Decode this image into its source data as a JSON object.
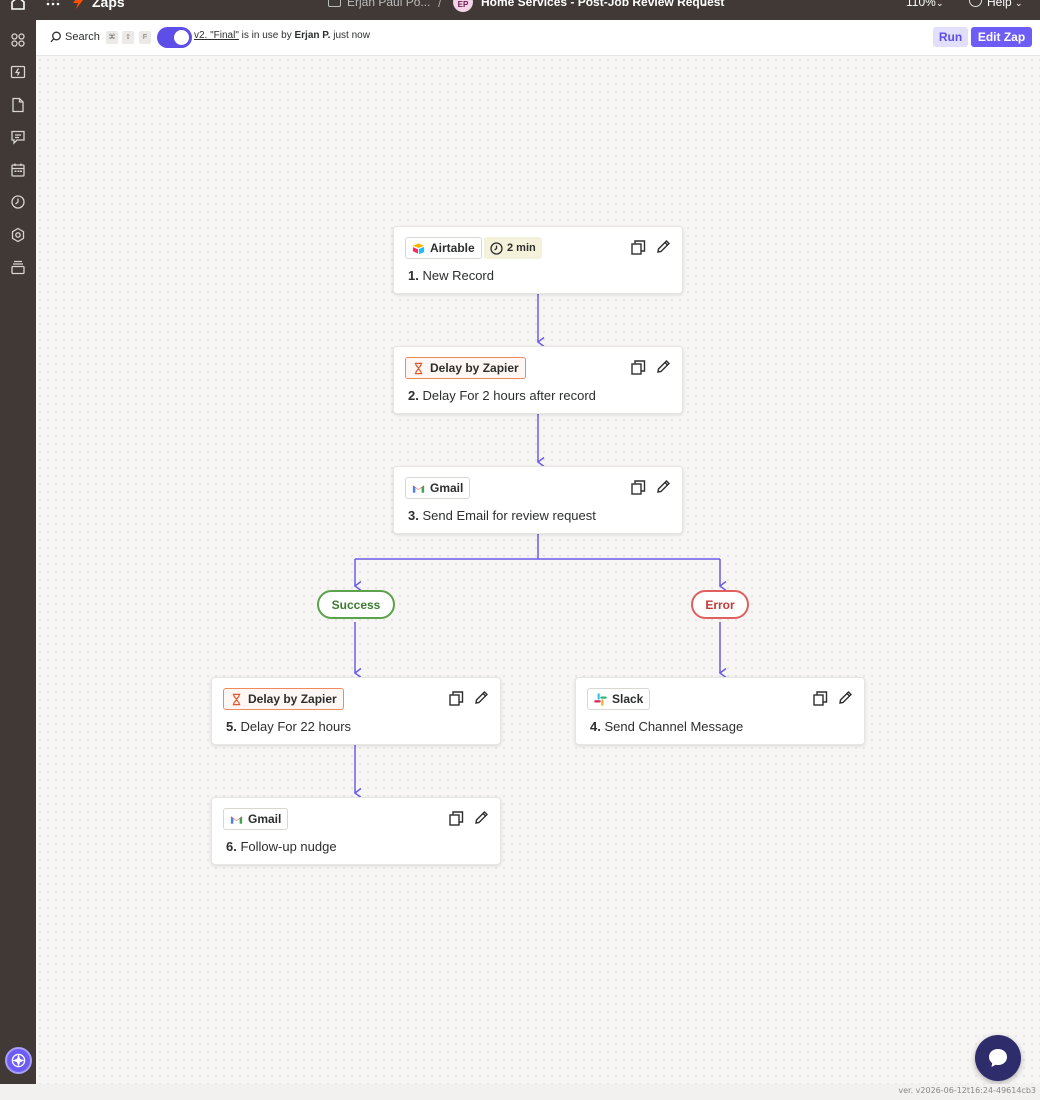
{
  "topbar": {
    "zaps_label": "Zaps",
    "folder_label": "Erjan Paul Po...",
    "separator": "/",
    "avatar_initials": "EP",
    "zap_name": "Home Services - Post-Job Review Request",
    "zoom": "110%",
    "help_label": "Help"
  },
  "toolbar": {
    "search_label": "Search",
    "shortcut_keys": [
      "⌘",
      "⇧",
      "F"
    ],
    "version_link": "v2. \"Final\"",
    "version_status": " is in use by ",
    "version_user": "Erjan P.",
    "version_time": " just now",
    "run_label": "Run",
    "edit_label": "Edit Zap"
  },
  "steps": {
    "s1": {
      "app": "Airtable",
      "badge": "2 min",
      "number": "1.",
      "title": "New Record",
      "app_icon": "airtable-icon"
    },
    "s2": {
      "app": "Delay by Zapier",
      "number": "2.",
      "title": "Delay For 2 hours after record",
      "app_icon": "hourglass-icon"
    },
    "s3": {
      "app": "Gmail",
      "number": "3.",
      "title": "Send Email for review request",
      "app_icon": "gmail-icon"
    },
    "s4": {
      "app": "Slack",
      "number": "4.",
      "title": "Send Channel Message",
      "app_icon": "slack-icon"
    },
    "s5": {
      "app": "Delay by Zapier",
      "number": "5.",
      "title": "Delay For 22 hours",
      "app_icon": "hourglass-icon"
    },
    "s6": {
      "app": "Gmail",
      "number": "6.",
      "title": "Follow-up nudge",
      "app_icon": "gmail-icon"
    }
  },
  "branches": {
    "success": "Success",
    "error": "Error"
  },
  "footer": {
    "version": "ver. v2026-06-12t16:24-49614cb3"
  },
  "colors": {
    "accent": "#6d5cf6",
    "connector": "#6a5ce8",
    "dark_chrome": "#403935",
    "success": "#5ba24d",
    "error": "#e06060",
    "delay_border": "#f08a5d"
  }
}
